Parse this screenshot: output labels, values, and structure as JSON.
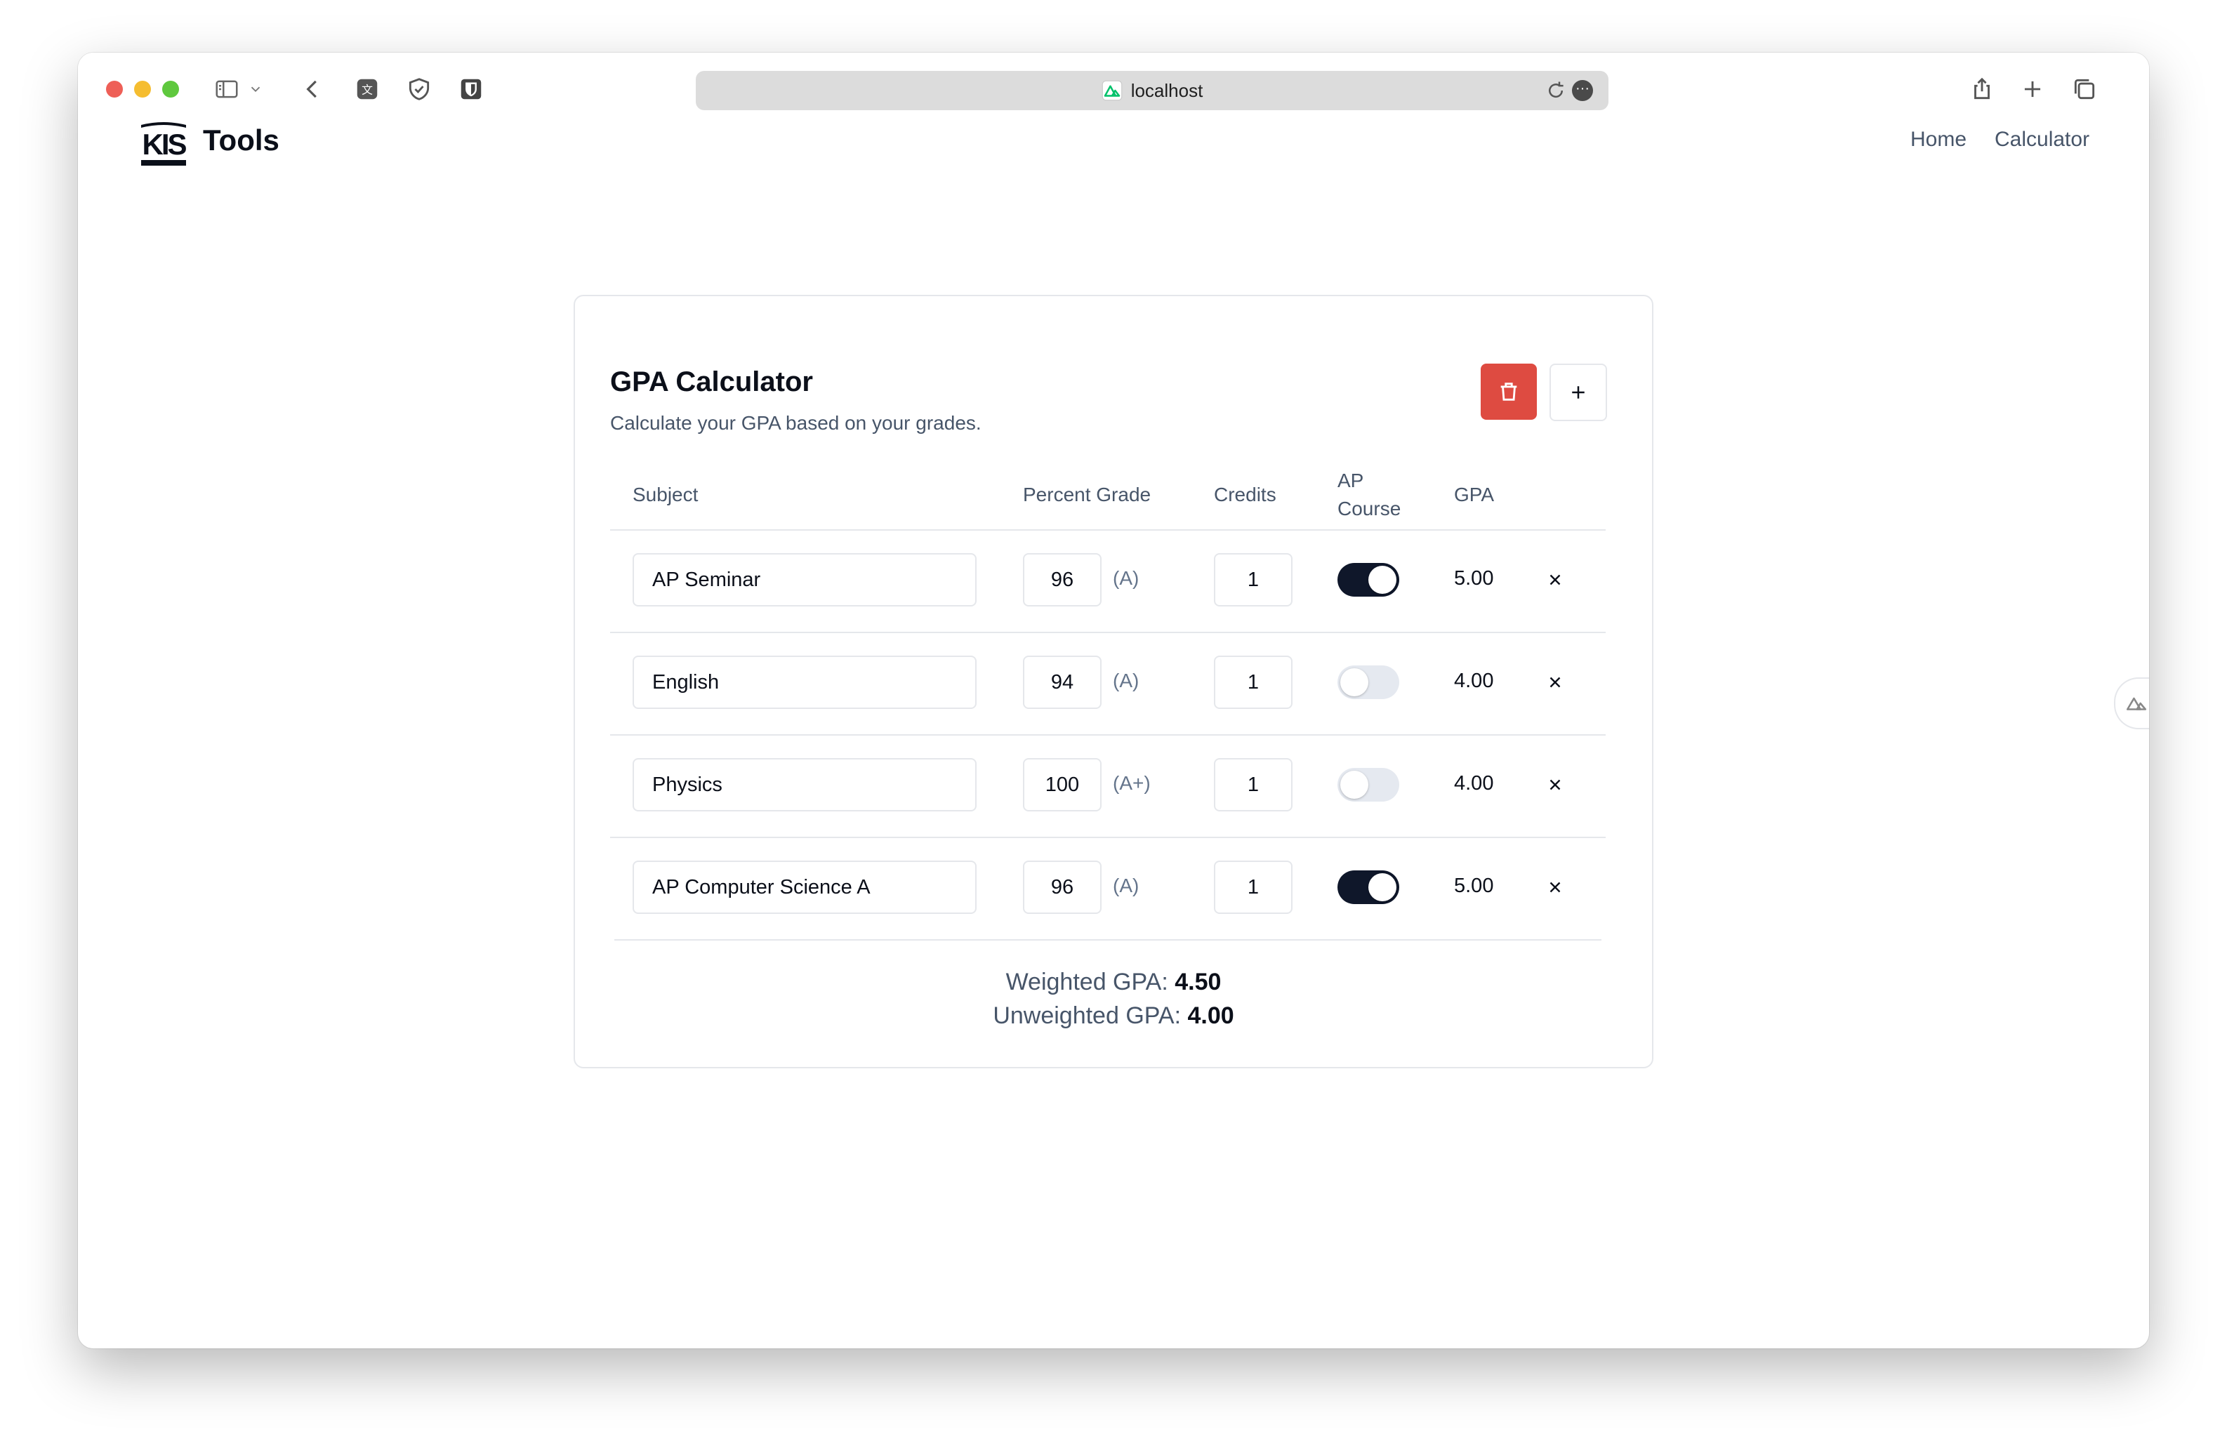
{
  "browser": {
    "url": "localhost"
  },
  "header": {
    "brand": "Tools",
    "nav": [
      {
        "label": "Home"
      },
      {
        "label": "Calculator"
      }
    ]
  },
  "card": {
    "title": "GPA Calculator",
    "subtitle": "Calculate your GPA based on your grades.",
    "columns": {
      "subject": "Subject",
      "percent_grade": "Percent Grade",
      "credits": "Credits",
      "ap_course_line1": "AP",
      "ap_course_line2": "Course",
      "gpa": "GPA"
    },
    "rows": [
      {
        "subject": "AP Seminar",
        "grade": "96",
        "letter": "(A)",
        "credits": "1",
        "ap": true,
        "gpa": "5.00"
      },
      {
        "subject": "English",
        "grade": "94",
        "letter": "(A)",
        "credits": "1",
        "ap": false,
        "gpa": "4.00"
      },
      {
        "subject": "Physics",
        "grade": "100",
        "letter": "(A+)",
        "credits": "1",
        "ap": false,
        "gpa": "4.00"
      },
      {
        "subject": "AP Computer Science A",
        "grade": "96",
        "letter": "(A)",
        "credits": "1",
        "ap": true,
        "gpa": "5.00"
      }
    ],
    "summary": {
      "weighted_label": "Weighted GPA:",
      "weighted_value": "4.50",
      "unweighted_label": "Unweighted GPA:",
      "unweighted_value": "4.00"
    }
  },
  "colors": {
    "accent_dark": "#0f172a",
    "delete_red": "#de4b41",
    "muted_text": "#475569"
  },
  "icons": [
    "sidebar-icon",
    "chevron-down-icon",
    "back-icon",
    "translate-icon",
    "shield-icon",
    "bitwarden-icon",
    "site-icon",
    "reload-icon",
    "more-icon",
    "share-icon",
    "new-tab-icon",
    "tabs-icon",
    "trash-icon",
    "plus-icon",
    "close-icon",
    "nuxt-devtools-icon"
  ]
}
